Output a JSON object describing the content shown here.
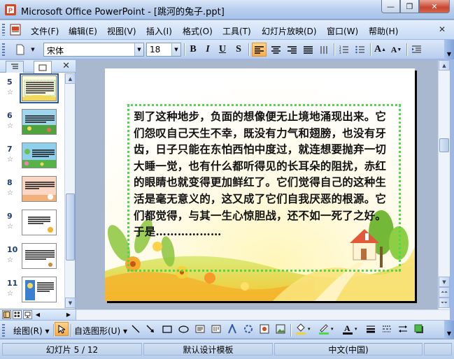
{
  "window": {
    "title": "Microsoft Office PowerPoint - [跳河的兔子.ppt]",
    "minimize_label": "—",
    "restore_label": "❐",
    "close_label": "✕"
  },
  "menubar": {
    "items": [
      {
        "label": "文件(F)"
      },
      {
        "label": "编辑(E)"
      },
      {
        "label": "视图(V)"
      },
      {
        "label": "插入(I)"
      },
      {
        "label": "格式(O)"
      },
      {
        "label": "工具(T)"
      },
      {
        "label": "幻灯片放映(D)"
      },
      {
        "label": "窗口(W)"
      },
      {
        "label": "帮助(H)"
      }
    ],
    "doc_close_label": "✕"
  },
  "toolbar": {
    "font_name": "宋体",
    "font_size": "18",
    "bold": "B",
    "italic": "I",
    "underline": "U",
    "shadow": "S",
    "increase_font": "A",
    "decrease_font": "A",
    "align": "left"
  },
  "left_pane": {
    "close_label": "✕",
    "star_glyph": "☆",
    "selected_slide": 5,
    "slides": [
      {
        "number": "5"
      },
      {
        "number": "6"
      },
      {
        "number": "7"
      },
      {
        "number": "8"
      },
      {
        "number": "9"
      },
      {
        "number": "10"
      },
      {
        "number": "11"
      }
    ]
  },
  "slide": {
    "body_text": "到了这种地步，负面的想像便无止境地涌现出来。它们怨叹自己天生不幸，既没有力气和翅膀，也没有牙齿，日子只能在东怕西怕中度过，就连想要抛弃一切大睡一觉，也有什么都听得见的长耳朵的阻扰，赤红的眼睛也就变得更加鲜红了。它们觉得自己的这种生活是毫无意义的，这又成了它们自我厌恶的根源。它们都觉得，与其一生心惊胆战，还不如一死了之好。\n于是………………",
    "border_color": "#4fd84b"
  },
  "drawbar": {
    "draw_label": "绘图(R)",
    "autoshapes_label": "自选图形(U)"
  },
  "statusbar": {
    "slide_info": "幻灯片 5 / 12",
    "design": "默认设计模板",
    "language": "中文(中国)"
  },
  "colors": {
    "accent": "#f7ad4a",
    "toolbar": "#c6daf5",
    "thumb_selected": "#2f5a9e"
  }
}
